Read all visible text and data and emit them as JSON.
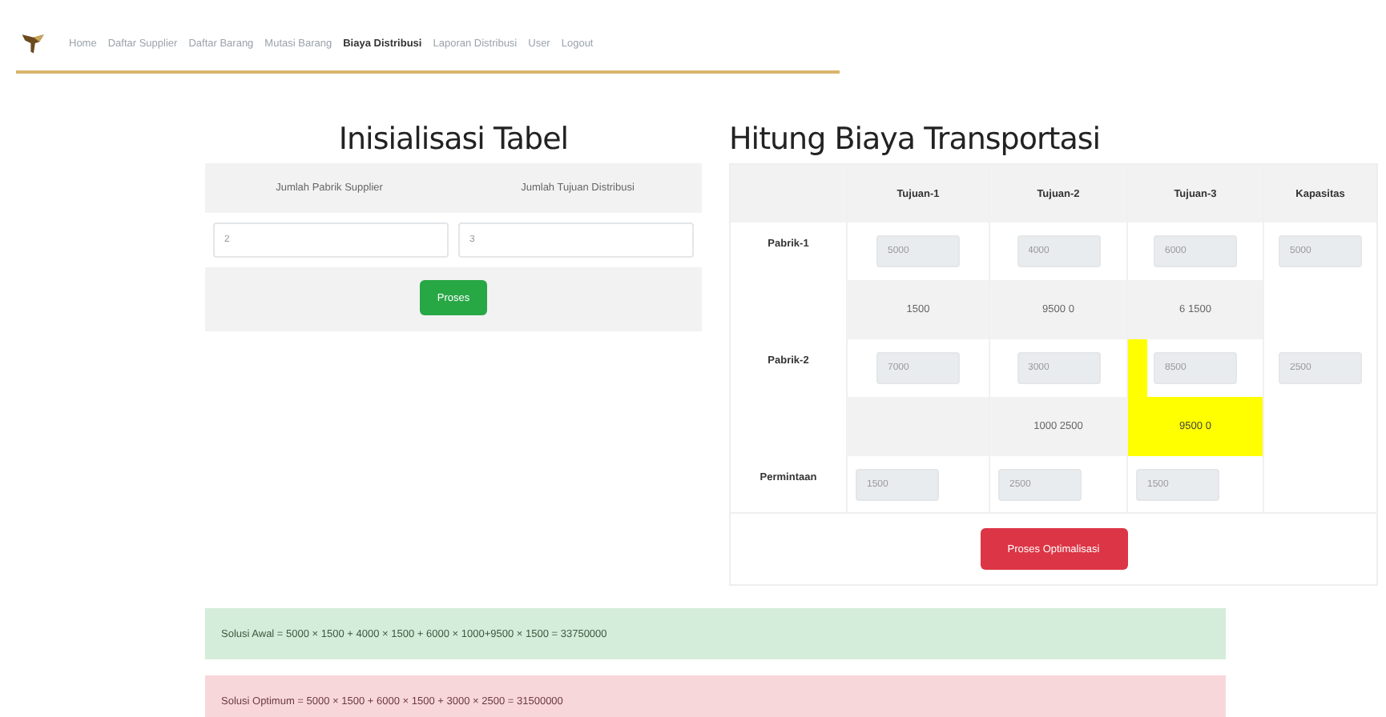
{
  "nav": {
    "items": [
      {
        "label": "Home",
        "selected": false
      },
      {
        "label": "Daftar Supplier",
        "selected": false
      },
      {
        "label": "Daftar Barang",
        "selected": false
      },
      {
        "label": "Mutasi Barang",
        "selected": false
      },
      {
        "label": "Biaya Distribusi",
        "selected": true
      },
      {
        "label": "Laporan Distribusi",
        "selected": false
      },
      {
        "label": "User",
        "selected": false
      },
      {
        "label": "Logout",
        "selected": false
      }
    ]
  },
  "init": {
    "title": "Inisialisasi Tabel",
    "columns": [
      "Jumlah Pabrik Supplier",
      "Jumlah Tujuan Distribusi"
    ],
    "values": [
      "2",
      "3"
    ],
    "button": "Proses"
  },
  "transport": {
    "title": "Hitung Biaya Transportasi",
    "columns": [
      "Tujuan-1",
      "Tujuan-2",
      "Tujuan-3",
      "Kapasitas"
    ],
    "factories": [
      {
        "name": "Pabrik-1",
        "costs": [
          {
            "value": "5000",
            "marked": false
          },
          {
            "value": "4000",
            "marked": false
          },
          {
            "value": "6000",
            "marked": false
          }
        ],
        "capacity": "5000",
        "allocations": [
          {
            "text": "1500",
            "highlighted": false
          },
          {
            "text": "9500 0",
            "highlighted": false
          },
          {
            "text": "6 1500",
            "highlighted": false
          }
        ]
      },
      {
        "name": "Pabrik-2",
        "costs": [
          {
            "value": "7000",
            "marked": false
          },
          {
            "value": "3000",
            "marked": false
          },
          {
            "value": "8500",
            "marked": true
          }
        ],
        "capacity": "2500",
        "allocations": [
          {
            "highlighted": false
          },
          {
            "text": "1000 2500",
            "highlighted": false
          },
          {
            "text": "9500 0",
            "highlighted": true
          }
        ]
      }
    ],
    "demand_label": "Permintaan",
    "demand": [
      "1500",
      "2500",
      "1500"
    ],
    "button": "Proses Optimalisasi"
  },
  "results": [
    {
      "kind": "success",
      "text": "Solusi Awal = 5000 × 1500 + 4000 × 1500 + 6000 × 1000+9500 × 1500 = 33750000"
    },
    {
      "kind": "danger",
      "text": "Solusi Optimum = 5000 × 1500 + 6000 × 1500 + 3000 × 2500 = 31500000"
    }
  ]
}
